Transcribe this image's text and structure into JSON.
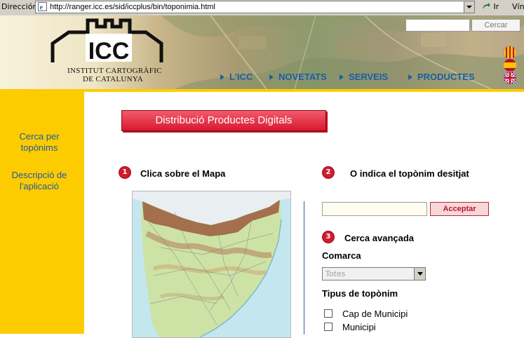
{
  "browser": {
    "address_label": "Dirección",
    "url": "http://ranger.icc.es/sid/iccplus/bin/toponimia.html",
    "go_label": "Ir",
    "links_label": "Vín"
  },
  "header": {
    "logo_text": "ICC",
    "logo_sub1": "INSTITUT CARTOGRÀFIC",
    "logo_sub2": "DE CATALUNYA",
    "search_placeholder": "",
    "search_button": "Cercar",
    "nav": [
      "L'ICC",
      "NOVETATS",
      "SERVEIS",
      "PRODUCTES"
    ],
    "languages": [
      "catalan-flag",
      "spanish-flag",
      "uk-flag"
    ]
  },
  "sidebar": {
    "items": [
      "Cerca per topònims",
      "Descripció de l'aplicació"
    ]
  },
  "main": {
    "title_button": "Distribució Productes Digitals",
    "step1": {
      "num": "1",
      "label": "Clica sobre el Mapa"
    },
    "step2": {
      "num": "2",
      "label": "O indica el topònim desitjat"
    },
    "toponim_input_value": "",
    "accept_button": "Acceptar",
    "step3": {
      "num": "3",
      "label": "Cerca avançada"
    },
    "comarca_label": "Comarca",
    "comarca_value": "Totes",
    "tipus_label": "Tipus de topònim",
    "tipus_options": [
      "Cap de Municipi",
      "Municipi"
    ]
  },
  "colors": {
    "sidebar": "#fdcc00",
    "nav_text": "#1b5fa3",
    "title_button": "#d8192f",
    "step_badge": "#d11b2f"
  }
}
